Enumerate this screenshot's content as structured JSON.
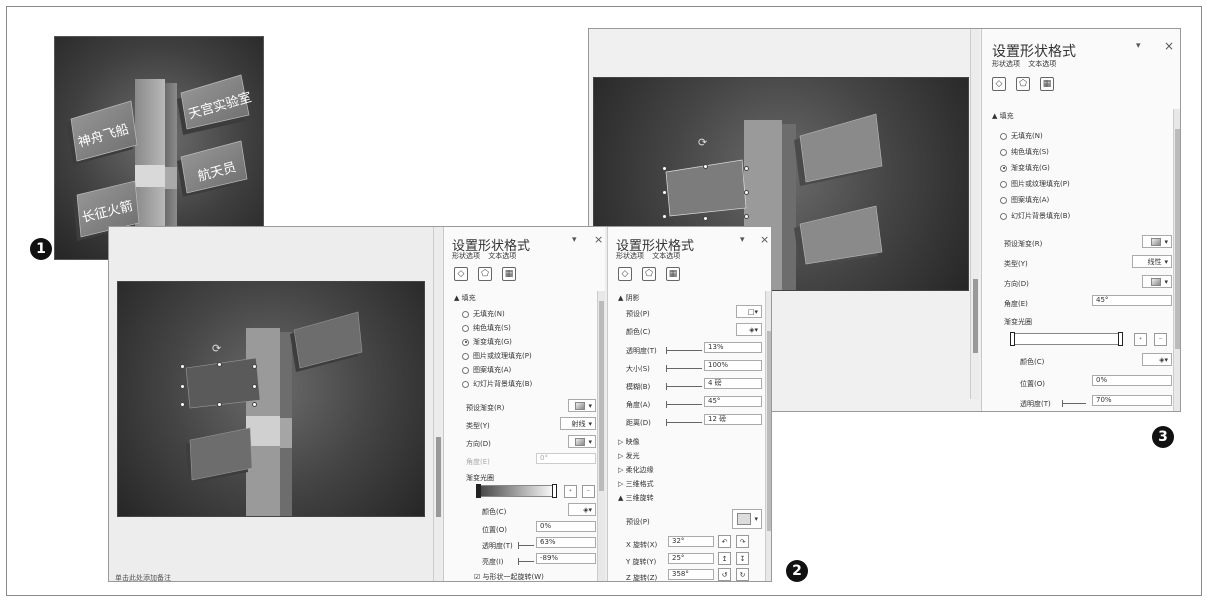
{
  "screenshot1": {
    "labels": [
      "天宫实验室",
      "神舟飞船",
      "航天员",
      "长征火箭"
    ]
  },
  "badges": {
    "b1": "❶",
    "b2": "❷",
    "b3": "❸"
  },
  "panel_fill": {
    "title": "设置形状格式",
    "tabs": [
      "形状选项",
      "文本选项"
    ],
    "section": "▲ 填充",
    "options": [
      "无填充(N)",
      "纯色填充(S)",
      "渐变填充(G)",
      "图片或纹理填充(P)",
      "图案填充(A)",
      "幻灯片背景填充(B)"
    ],
    "preset_label": "预设渐变(R)",
    "type_label": "类型(Y)",
    "type_value": "射线",
    "direction_label": "方向(D)",
    "angle_label": "角度(E)",
    "angle_value": "0°",
    "stops_label": "渐变光圈",
    "color_label": "颜色(C)",
    "position_label": "位置(O)",
    "position_value": "0%",
    "transparency_label": "透明度(T)",
    "transparency_value": "63%",
    "brightness_label": "亮度(I)",
    "brightness_value": "-89%",
    "rotate_with_shape": "与形状一起旋转(W)"
  },
  "panel_effects": {
    "title": "设置形状格式",
    "tabs": [
      "形状选项",
      "文本选项"
    ],
    "shadow_section": "▲ 阴影",
    "preset_label": "预设(P)",
    "color_label": "颜色(C)",
    "rows": [
      {
        "label": "透明度(T)",
        "value": "13%"
      },
      {
        "label": "大小(S)",
        "value": "100%"
      },
      {
        "label": "模糊(B)",
        "value": "4 磅"
      },
      {
        "label": "角度(A)",
        "value": "45°"
      },
      {
        "label": "距离(D)",
        "value": "12 磅"
      }
    ],
    "collapsed": [
      "▷ 映像",
      "▷ 发光",
      "▷ 柔化边缘",
      "▷ 三维格式"
    ],
    "rot_section": "▲ 三维旋转",
    "rot_preset_label": "预设(P)",
    "rot_rows": [
      {
        "label": "X 旋转(X)",
        "value": "32°"
      },
      {
        "label": "Y 旋转(Y)",
        "value": "25°"
      },
      {
        "label": "Z 旋转(Z)",
        "value": "358°"
      }
    ]
  },
  "panel_three": {
    "title": "设置形状格式",
    "tabs": [
      "形状选项",
      "文本选项"
    ],
    "section": "▲ 填充",
    "options": [
      "无填充(N)",
      "纯色填充(S)",
      "渐变填充(G)",
      "图片或纹理填充(P)",
      "图案填充(A)",
      "幻灯片背景填充(B)"
    ],
    "preset_label": "预设渐变(R)",
    "type_label": "类型(Y)",
    "type_value": "线性",
    "direction_label": "方向(D)",
    "angle_label": "角度(E)",
    "angle_value": "45°",
    "stops_label": "渐变光圈",
    "color_label": "颜色(C)",
    "position_label": "位置(O)",
    "position_value": "0%",
    "transparency_label": "透明度(T)",
    "transparency_value": "70%"
  },
  "status_text": "单击此处添加备注",
  "icons": {
    "pin": "▾",
    "close": "×",
    "rotate": "⟳",
    "checkbox": "☑"
  }
}
